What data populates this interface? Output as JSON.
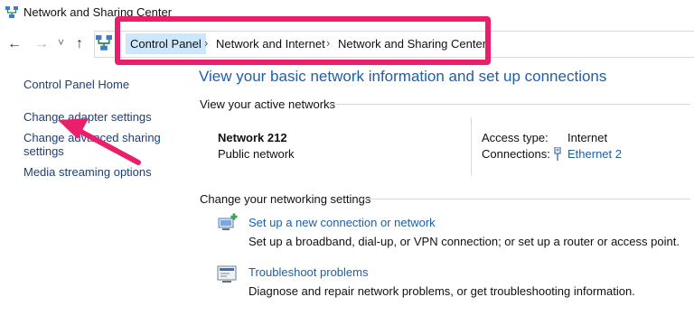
{
  "window": {
    "title": "Network and Sharing Center"
  },
  "nav": {
    "back_glyph": "←",
    "forward_glyph": "→",
    "recent_glyph": "˅",
    "up_glyph": "↑"
  },
  "breadcrumb": {
    "items": [
      "Control Panel",
      "Network and Internet",
      "Network and Sharing Center"
    ],
    "separator": "›"
  },
  "sidebar": {
    "home": "Control Panel Home",
    "links": [
      "Change adapter settings",
      "Change advanced sharing",
      "settings",
      "Media streaming options"
    ]
  },
  "main": {
    "heading": "View your basic network information and set up connections",
    "active_networks": {
      "title": "View your active networks",
      "network_name": "Network 212",
      "network_type": "Public network",
      "access_type_label": "Access type:",
      "access_type_value": "Internet",
      "connections_label": "Connections:",
      "connections_value": "Ethernet 2"
    },
    "change_settings": {
      "title": "Change your networking settings",
      "tasks": [
        {
          "link": "Set up a new connection or network",
          "description": "Set up a broadband, dial-up, or VPN connection; or set up a router or access point."
        },
        {
          "link": "Troubleshoot problems",
          "description": "Diagnose and repair network problems, or get troubleshooting information."
        }
      ]
    }
  },
  "annotation": {
    "highlight_color": "#ea1f6b"
  },
  "icons": [
    "network-center-icon",
    "back-icon",
    "forward-icon",
    "recent-locations-icon",
    "up-icon",
    "ethernet-icon",
    "new-connection-icon",
    "troubleshoot-icon"
  ]
}
